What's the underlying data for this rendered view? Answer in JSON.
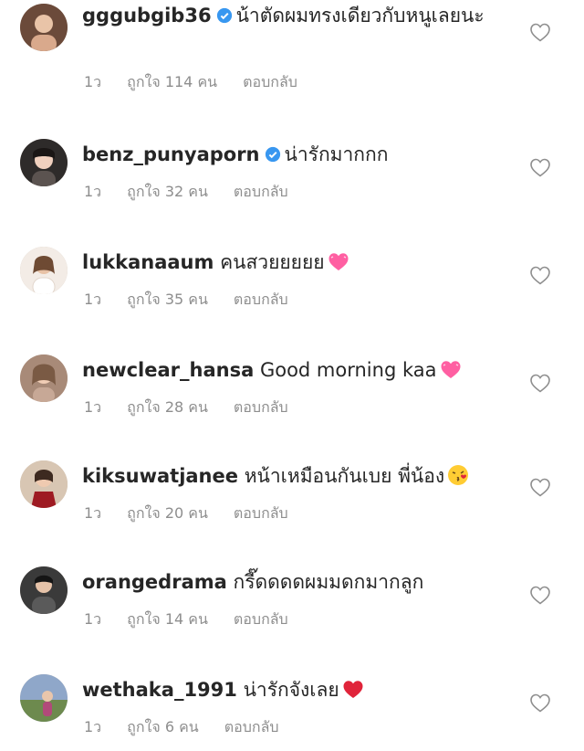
{
  "comments": [
    {
      "username": "gggubgib36",
      "verified": true,
      "text": "น้าตัดผมทรงเดียวกับหนูเลยนะ",
      "time": "1ว",
      "likes": "ถูกใจ 114 คน",
      "reply": "ตอบกลับ",
      "emoji": ""
    },
    {
      "username": "benz_punyaporn",
      "verified": true,
      "text": "น่ารักมากกก",
      "time": "1ว",
      "likes": "ถูกใจ 32 คน",
      "reply": "ตอบกลับ",
      "emoji": ""
    },
    {
      "username": "lukkanaaum",
      "verified": false,
      "text": "คนสวยยยยย",
      "time": "1ว",
      "likes": "ถูกใจ 35 คน",
      "reply": "ตอบกลับ",
      "emoji": "pink-heart-icon"
    },
    {
      "username": "newclear_hansa",
      "verified": false,
      "text": "Good morning kaa",
      "time": "1ว",
      "likes": "ถูกใจ 28 คน",
      "reply": "ตอบกลับ",
      "emoji": "pink-heart-icon"
    },
    {
      "username": "kiksuwatjanee",
      "verified": false,
      "text": "หน้าเหมือนกันเบย พี่น้อง",
      "time": "1ว",
      "likes": "ถูกใจ 20 คน",
      "reply": "ตอบกลับ",
      "emoji": "kissing-face-icon"
    },
    {
      "username": "orangedrama",
      "verified": false,
      "text": "กรี๊ดดดดผมมดกมากลูก",
      "time": "1ว",
      "likes": "ถูกใจ 14 คน",
      "reply": "ตอบกลับ",
      "emoji": ""
    },
    {
      "username": "wethaka_1991",
      "verified": false,
      "text": "น่ารักจังเลย",
      "time": "1ว",
      "likes": "ถูกใจ 6 คน",
      "reply": "ตอบกลับ",
      "emoji": "red-heart-icon"
    }
  ],
  "colors": {
    "verified": "#3897f0",
    "meta": "#8e8e8e",
    "pink_heart": "#ff5fa2",
    "red_heart": "#e0243a"
  }
}
